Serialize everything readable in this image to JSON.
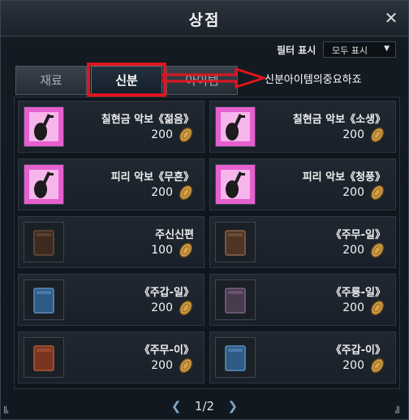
{
  "window": {
    "title": "상점",
    "close_icon": "close-icon"
  },
  "filter": {
    "label": "필터 표시",
    "selected": "모두 표시"
  },
  "tabs": [
    {
      "label": "재료"
    },
    {
      "label": "신분"
    },
    {
      "label": "아이템"
    }
  ],
  "annotation": {
    "text": "신분아이템의중요하죠",
    "color": "#e0141e"
  },
  "items": [
    {
      "name": "칠현금 악보《젊음》",
      "price": "200",
      "icon": "music-score-icon"
    },
    {
      "name": "칠현금 악보《소생》",
      "price": "200",
      "icon": "music-score-icon"
    },
    {
      "name": "피리 악보《무흔》",
      "price": "200",
      "icon": "music-score-icon"
    },
    {
      "name": "피리 악보《청풍》",
      "price": "200",
      "icon": "music-score-icon"
    },
    {
      "name": "주신신편",
      "price": "100",
      "icon": "book-icon"
    },
    {
      "name": "《주무-일》",
      "price": "200",
      "icon": "book-icon"
    },
    {
      "name": "《주갑-일》",
      "price": "200",
      "icon": "book-icon"
    },
    {
      "name": "《주룡-일》",
      "price": "200",
      "icon": "book-icon"
    },
    {
      "name": "《주무-이》",
      "price": "200",
      "icon": "book-icon"
    },
    {
      "name": "《주갑-이》",
      "price": "200",
      "icon": "book-icon"
    }
  ],
  "pagination": {
    "text": "1/2"
  },
  "colors": {
    "accent_pink": "#e65fcf",
    "coin": "#d6a24a",
    "highlight": "#e0141e"
  }
}
